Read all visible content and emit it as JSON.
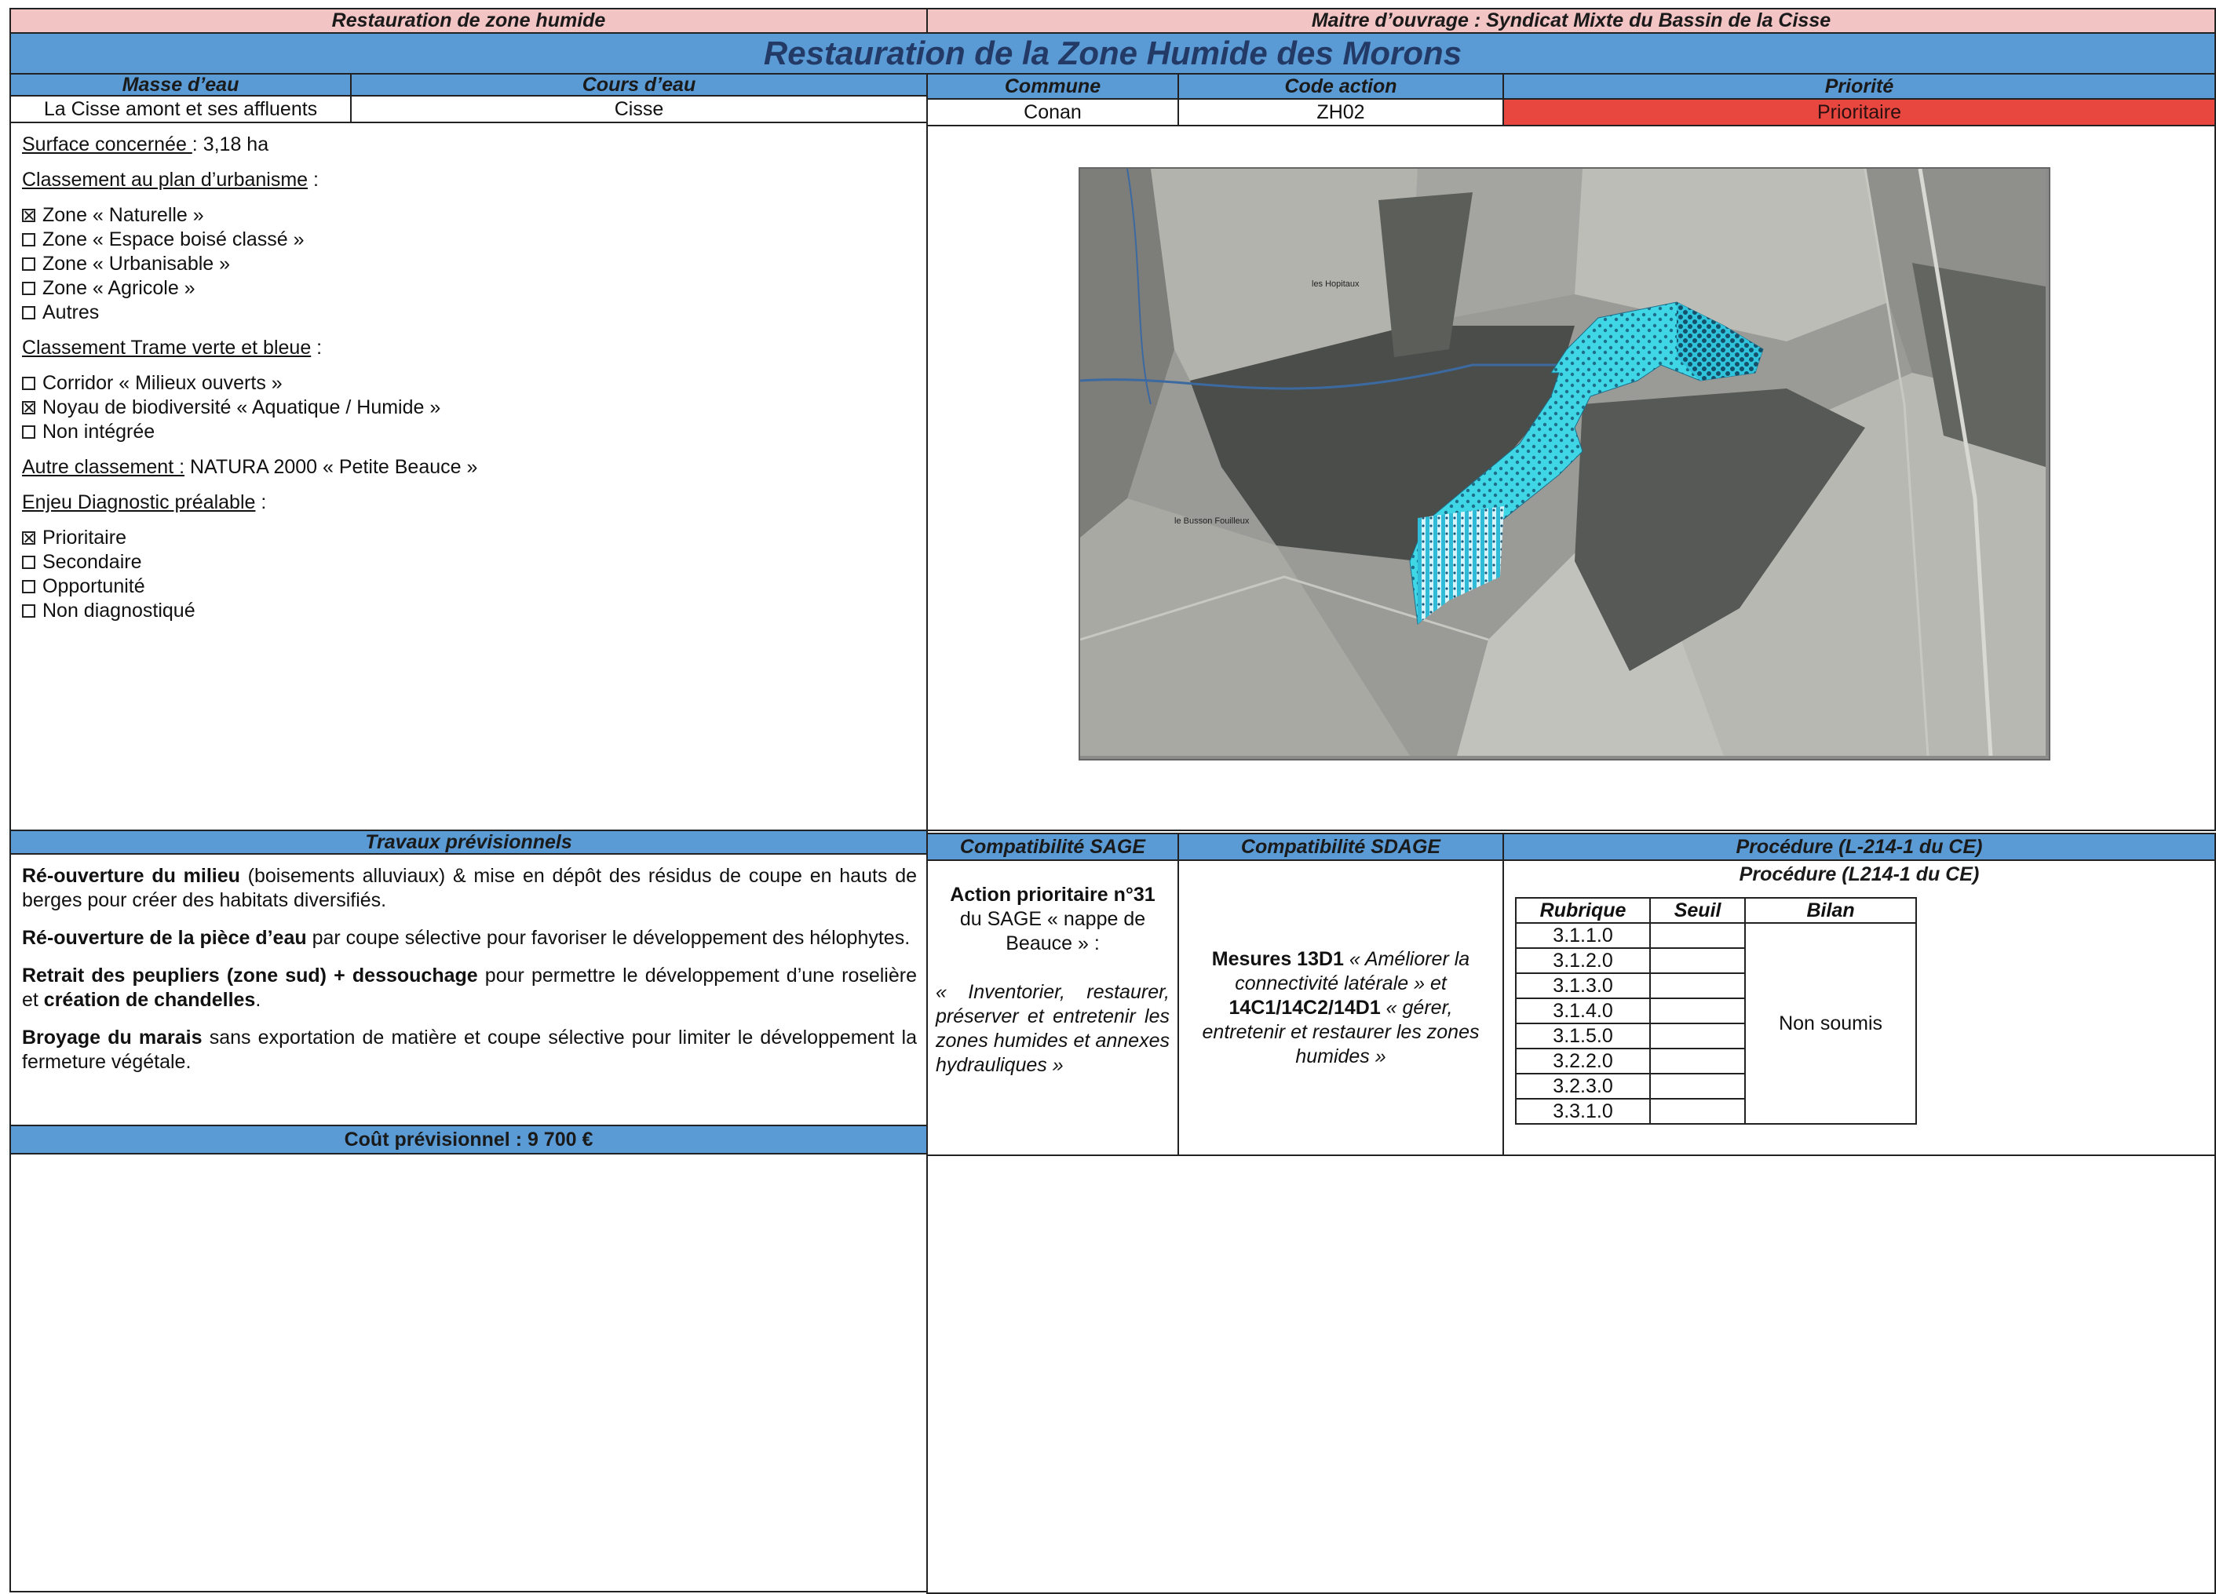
{
  "header": {
    "left_title": "Restauration de zone humide",
    "right_title": "Maitre d’ouvrage : Syndicat Mixte du Bassin de la Cisse",
    "main_title": "Restauration de la Zone Humide des Morons"
  },
  "info": {
    "masse_label": "Masse d’eau",
    "masse_value": "La Cisse amont et ses affluents",
    "cours_label": "Cours d’eau",
    "cours_value": "Cisse",
    "commune_label": "Commune",
    "commune_value": "Conan",
    "code_label": "Code action",
    "code_value": "ZH02",
    "priorite_label": "Priorité",
    "priorite_value": "Prioritaire",
    "priorite_color": "#e8473f"
  },
  "details": {
    "surface_label": "Surface concernée ",
    "surface_value": ": 3,18 ha",
    "urbanisme_label": "Classement au plan d’urbanisme",
    "urbanisme_suffix": " :",
    "urbanisme_items": [
      {
        "label": "Zone « Naturelle »",
        "checked": true
      },
      {
        "label": "Zone « Espace boisé classé »",
        "checked": false
      },
      {
        "label": "Zone « Urbanisable »",
        "checked": false
      },
      {
        "label": "Zone « Agricole »",
        "checked": false
      },
      {
        "label": "Autres",
        "checked": false
      }
    ],
    "trame_label": "Classement Trame verte et bleue",
    "trame_suffix": " :",
    "trame_items": [
      {
        "label": "Corridor « Milieux ouverts »",
        "checked": false
      },
      {
        "label": "Noyau de biodiversité « Aquatique / Humide »",
        "checked": true
      },
      {
        "label": "Non intégrée",
        "checked": false
      }
    ],
    "autre_label": "Autre classement :",
    "autre_value": " NATURA 2000 « Petite Beauce »",
    "enjeu_label": "Enjeu Diagnostic préalable",
    "enjeu_suffix": " :",
    "enjeu_items": [
      {
        "label": "Prioritaire",
        "checked": true
      },
      {
        "label": "Secondaire",
        "checked": false
      },
      {
        "label": "Opportunité",
        "checked": false
      },
      {
        "label": "Non diagnostiqué",
        "checked": false
      }
    ]
  },
  "map": {
    "label_hopitaux": "les Hopitaux",
    "label_busson": "le Busson Fouilleux"
  },
  "travaux": {
    "title": "Travaux prévisionnels",
    "p1_bold": "Ré-ouverture du milieu",
    "p1_rest": " (boisements alluviaux) & mise en dépôt des résidus de coupe en hauts de berges pour créer des habitats diversifiés.",
    "p2_bold": "Ré-ouverture de la pièce d’eau",
    "p2_rest": " par coupe sélective pour favoriser le développement des hélophytes.",
    "p3_bold": "Retrait des peupliers (zone sud) + dessouchage",
    "p3_mid": " pour permettre le développement d’une roselière et ",
    "p3_bold2": "création de chandelles",
    "p3_end": ".",
    "p4_bold": "Broyage du marais",
    "p4_rest": " sans exportation de matière et coupe sélective pour limiter le développement la fermeture végétale."
  },
  "cout": {
    "label": "Coût prévisionnel : 9 700 €"
  },
  "sage": {
    "title": "Compatibilité SAGE",
    "bold": "Action prioritaire n°31",
    "plain": "du SAGE « nappe de Beauce » :",
    "italic": "« Inventorier, restaurer, préserver et entretenir les zones humides et annexes hydrauliques »"
  },
  "sdage": {
    "title": "Compatibilité SDAGE",
    "b1": "Mesures 13D1",
    "i1": " « Améliorer la connectivité latérale » et ",
    "b2": "14C1/14C2/14D1",
    "i2": " « gérer, entretenir et restaurer les zones humides »"
  },
  "procedure": {
    "title": "Procédure (L-214-1 du CE)",
    "subtitle": "Procédure (L214-1 du CE)",
    "col_rubrique": "Rubrique",
    "col_seuil": "Seuil",
    "col_bilan": "Bilan",
    "rubriques": [
      "3.1.1.0",
      "3.1.2.0",
      "3.1.3.0",
      "3.1.4.0",
      "3.1.5.0",
      "3.2.2.0",
      "3.2.3.0",
      "3.3.1.0"
    ],
    "bilan": "Non soumis"
  }
}
